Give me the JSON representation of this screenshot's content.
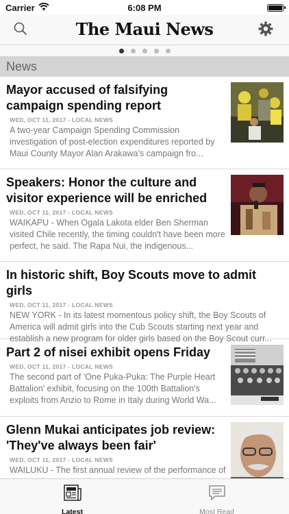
{
  "status_bar": {
    "carrier": "Carrier",
    "time": "6:08 PM"
  },
  "nav": {
    "title": "The Maui News",
    "left_icon": "search-icon",
    "right_icon": "gear-icon"
  },
  "pager": {
    "total_pages": 5,
    "active_index": 0
  },
  "section": {
    "title": "News"
  },
  "articles": [
    {
      "title": "Mayor accused of falsifying campaign spending report",
      "meta": "Wed, Oct 11, 2017 - LOCAL NEWS",
      "summary": "A two-year Campaign Spending Commission investigation of post-election expenditures reported by Maui County Mayor Alan Arakawa's campaign fro...",
      "has_thumb": true
    },
    {
      "title": "Speakers: Honor the culture and visitor experience will be enriched",
      "meta": "Wed, Oct 11, 2017 - LOCAL NEWS",
      "summary": "WAIKAPU - When Ogala Lakota elder Ben Sherman visited Chile recently, the timing couldn't have been more perfect, he said. The Rapa Nui, the indigenous...",
      "has_thumb": true
    },
    {
      "title": "In historic shift, Boy Scouts move to admit girls",
      "meta": "Wed, Oct 11, 2017 - LOCAL NEWS",
      "summary": "NEW YORK - In its latest momentous policy shift, the Boy Scouts of America will admit girls into the Cub Scouts starting next year and establish a new program for older girls based on the Boy Scout curr...",
      "has_thumb": false
    },
    {
      "title": "Part 2 of nisei exhibit opens Friday",
      "meta": "Wed, Oct 11, 2017 - LOCAL NEWS",
      "summary": "The second part of 'One Puka-Puka: The Purple Heart Battalion' exhibit, focusing on the 100th Battalion's exploits from Anzio to Rome in Italy during World Wa...",
      "has_thumb": true
    },
    {
      "title": "Glenn Mukai anticipates job review: 'They've always been fair'",
      "meta": "Wed, Oct 11, 2017 - LOCAL NEWS",
      "summary": "WAILUKU - The first annual review of the performance of county Liquor Control Director Glenn Mukai and...",
      "has_thumb": true
    }
  ],
  "tabs": [
    {
      "label": "Latest",
      "icon": "newspaper-icon",
      "active": true
    },
    {
      "label": "Most Read",
      "icon": "message-icon",
      "active": false
    }
  ]
}
